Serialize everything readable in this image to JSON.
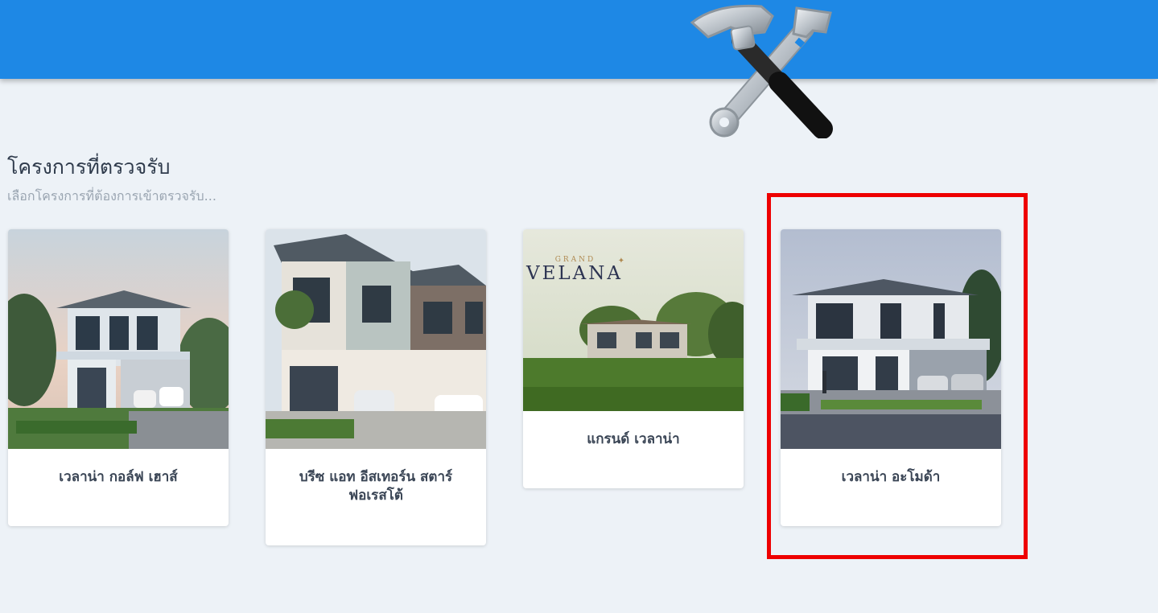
{
  "header": {
    "bar_color": "#1e88e5",
    "logo_icon": "hammer-wrench-icon"
  },
  "section": {
    "title": "โครงการที่ตรวจรับ",
    "subtitle": "เลือกโครงการที่ต้องการเข้าตรวจรับ..."
  },
  "projects": [
    {
      "name": "เวลาน่า กอล์ฟ เฮาส์"
    },
    {
      "name": "บรีซ แอท อีสเทอร์น สตาร์ ฟอเรสโต้"
    },
    {
      "name": "แกรนด์ เวลาน่า",
      "image_text_small": "GRAND",
      "image_text_logo": "VELANA"
    },
    {
      "name": "เวลาน่า อะโมด้า"
    }
  ],
  "highlight_color": "#ee0000"
}
